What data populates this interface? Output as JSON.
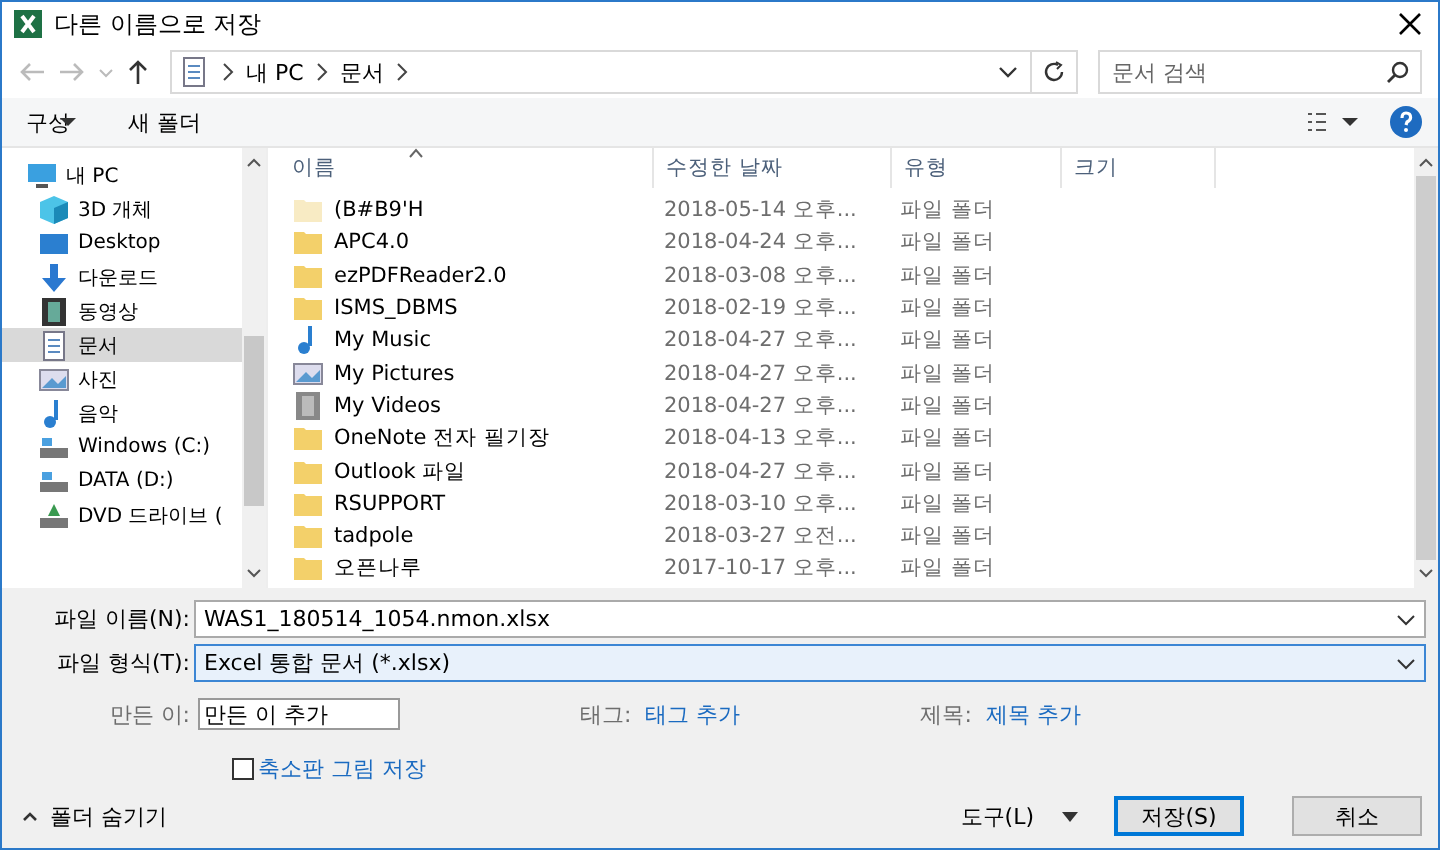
{
  "window": {
    "title": "다른 이름으로 저장"
  },
  "address": {
    "path": [
      "내 PC",
      "문서"
    ]
  },
  "search": {
    "placeholder": "문서 검색"
  },
  "toolbar": {
    "organize": "구성",
    "new_folder": "새 폴더"
  },
  "sidebar": {
    "items": [
      {
        "label": "내 PC",
        "kind": "pc",
        "selected": false,
        "children": [
          {
            "label": "3D 개체",
            "kind": "cube",
            "selected": false
          },
          {
            "label": "Desktop",
            "kind": "desktop",
            "selected": false
          },
          {
            "label": "다운로드",
            "kind": "download",
            "selected": false
          },
          {
            "label": "동영상",
            "kind": "video",
            "selected": false
          },
          {
            "label": "문서",
            "kind": "doc",
            "selected": true
          },
          {
            "label": "사진",
            "kind": "picture",
            "selected": false
          },
          {
            "label": "음악",
            "kind": "music",
            "selected": false
          },
          {
            "label": "Windows (C:)",
            "kind": "drive",
            "selected": false
          },
          {
            "label": "DATA (D:)",
            "kind": "drive",
            "selected": false
          },
          {
            "label": "DVD 드라이브 (",
            "kind": "dvd",
            "selected": false
          }
        ]
      }
    ]
  },
  "table": {
    "columns": [
      "이름",
      "수정한 날짜",
      "유형",
      "크기"
    ],
    "rows": [
      {
        "kind": "folder",
        "hidden": true,
        "name": "(B#B9'H",
        "date": "2018-05-14 오후...",
        "type": "파일 폴더"
      },
      {
        "kind": "folder",
        "hidden": false,
        "name": "APC4.0",
        "date": "2018-04-24 오후...",
        "type": "파일 폴더"
      },
      {
        "kind": "folder",
        "hidden": false,
        "name": "ezPDFReader2.0",
        "date": "2018-03-08 오후...",
        "type": "파일 폴더"
      },
      {
        "kind": "folder",
        "hidden": false,
        "name": "ISMS_DBMS",
        "date": "2018-02-19 오후...",
        "type": "파일 폴더"
      },
      {
        "kind": "music",
        "hidden": false,
        "name": "My Music",
        "date": "2018-04-27 오후...",
        "type": "파일 폴더"
      },
      {
        "kind": "pictures",
        "hidden": false,
        "name": "My Pictures",
        "date": "2018-04-27 오후...",
        "type": "파일 폴더"
      },
      {
        "kind": "videos",
        "hidden": false,
        "name": "My Videos",
        "date": "2018-04-27 오후...",
        "type": "파일 폴더"
      },
      {
        "kind": "folder",
        "hidden": false,
        "name": "OneNote 전자 필기장",
        "date": "2018-04-13 오후...",
        "type": "파일 폴더"
      },
      {
        "kind": "folder",
        "hidden": false,
        "name": "Outlook 파일",
        "date": "2018-04-27 오후...",
        "type": "파일 폴더"
      },
      {
        "kind": "folder",
        "hidden": false,
        "name": "RSUPPORT",
        "date": "2018-03-10 오후...",
        "type": "파일 폴더"
      },
      {
        "kind": "folder",
        "hidden": false,
        "name": "tadpole",
        "date": "2018-03-27 오전...",
        "type": "파일 폴더"
      },
      {
        "kind": "folder",
        "hidden": false,
        "name": "오픈나루",
        "date": "2017-10-17 오후...",
        "type": "파일 폴더"
      }
    ]
  },
  "form": {
    "file_name": {
      "label": "파일 이름(N):",
      "value": "WAS1_180514_1054.nmon.xlsx"
    },
    "file_type": {
      "label": "파일 형식(T):",
      "value": "Excel 통합 문서 (*.xlsx)",
      "selected": true
    },
    "author": {
      "label": "만든 이:",
      "value": "만든 이 추가"
    },
    "tags": {
      "label": "태그:",
      "link": "태그 추가"
    },
    "title": {
      "label": "제목:",
      "link": "제목 추가"
    },
    "thumbnail": {
      "label": "축소판 그림 저장",
      "checked": false
    }
  },
  "footer": {
    "hide_folders": "폴더 숨기기",
    "tools": "도구(L)",
    "save": "저장(S)",
    "cancel": "취소"
  }
}
